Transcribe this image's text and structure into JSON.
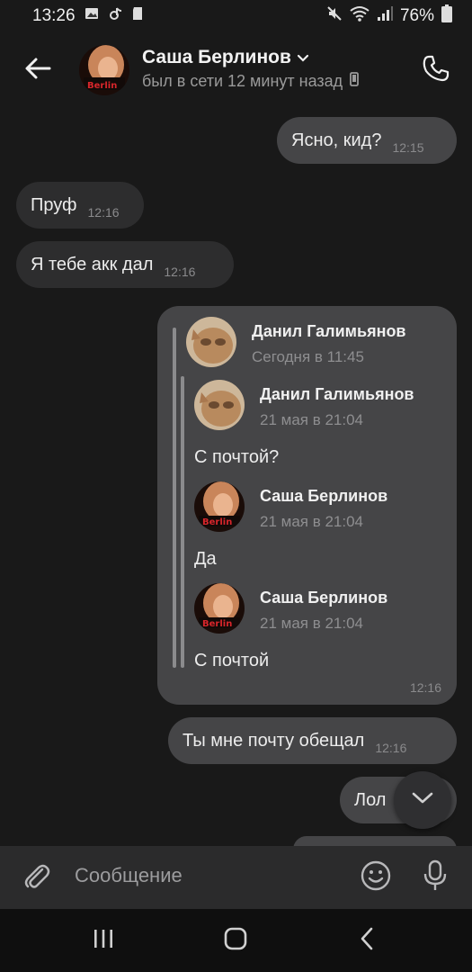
{
  "status_bar": {
    "time": "13:26",
    "battery": "76%"
  },
  "header": {
    "contact_name": "Саша Берлинов",
    "status": "был в сети 12 минут назад",
    "avatar_badge": "Berlin"
  },
  "messages": [
    {
      "text": "Ясно, кид?",
      "time": "12:15"
    },
    {
      "text": "Пруф",
      "time": "12:16"
    },
    {
      "text": "Я тебе акк дал",
      "time": "12:16"
    },
    {
      "text": "Ты мне почту обещал",
      "time": "12:16"
    },
    {
      "text": "Лол",
      "time": ""
    }
  ],
  "forwarded": {
    "time": "12:16",
    "outer": {
      "name": "Данил Галимьянов",
      "date": "Сегодня в 11:45"
    },
    "items": [
      {
        "name": "Данил Галимьянов",
        "date": "21 мая в 21:04",
        "text": "С почтой?"
      },
      {
        "name": "Саша Берлинов",
        "date": "21 мая в 21:04",
        "text": "Да"
      },
      {
        "name": "Саша Берлинов",
        "date": "21 мая в 21:04",
        "text": "С почтой"
      }
    ]
  },
  "composer": {
    "placeholder": "Сообщение"
  },
  "icons": {
    "back": "back-arrow-icon",
    "call": "phone-icon",
    "attach": "paperclip-icon",
    "emoji": "emoji-icon",
    "mic": "microphone-icon",
    "scroll": "chevron-down-icon"
  },
  "colors": {
    "background": "#191919",
    "incoming_bubble": "#2d2d2e",
    "outgoing_bubble": "#454547",
    "composer": "#2b2b2c"
  }
}
